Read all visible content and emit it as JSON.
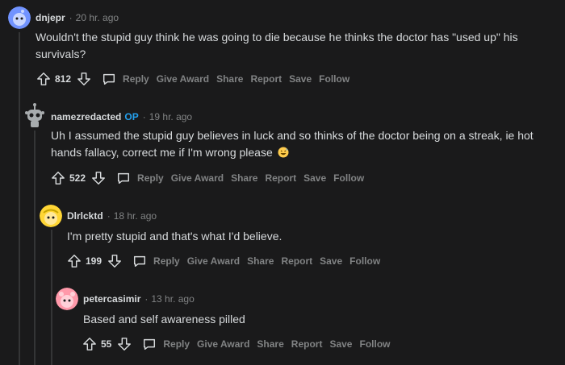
{
  "comments": [
    {
      "author": "dnjepr",
      "op_badge": "",
      "time": "20 hr. ago",
      "text": "Wouldn't the stupid guy think he was going to die because he thinks the doctor has \"used up\" his survivals?",
      "score": "812",
      "avatar_icon": "snoo-blue-avatar",
      "actions": [
        "Reply",
        "Give Award",
        "Share",
        "Report",
        "Save",
        "Follow"
      ]
    },
    {
      "author": "namezredacted",
      "op_badge": "OP",
      "time": "19 hr. ago",
      "text": "Uh I assumed the stupid guy believes in luck and so thinks of the doctor being on a streak, ie hot hands fallacy, correct me if I'm wrong please",
      "emoji": "grinning-sweat-emoji",
      "score": "522",
      "avatar_icon": "snoo-robot-avatar",
      "actions": [
        "Reply",
        "Give Award",
        "Share",
        "Report",
        "Save",
        "Follow"
      ]
    },
    {
      "author": "Dlrlcktd",
      "op_badge": "",
      "time": "18 hr. ago",
      "text": "I'm pretty stupid and that's what I'd believe.",
      "score": "199",
      "avatar_icon": "snoo-yellow-avatar",
      "actions": [
        "Reply",
        "Give Award",
        "Share",
        "Report",
        "Save",
        "Follow"
      ]
    },
    {
      "author": "petercasimir",
      "op_badge": "",
      "time": "13 hr. ago",
      "text": "Based and self awareness pilled",
      "score": "55",
      "avatar_icon": "snoo-pink-avatar",
      "actions": [
        "Reply",
        "Give Award",
        "Share",
        "Report",
        "Save",
        "Follow"
      ]
    }
  ],
  "colors": {
    "background": "#1a1a1b",
    "text": "#d7dadc",
    "muted": "#818384",
    "op_blue": "#24a0ed",
    "thread_line": "#343536"
  }
}
